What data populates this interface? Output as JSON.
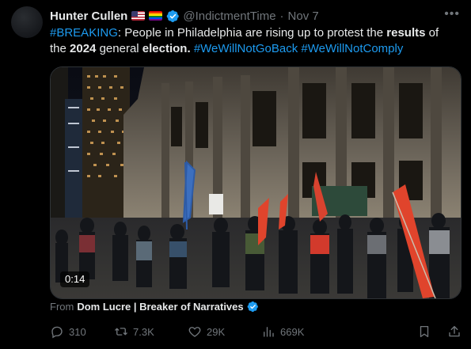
{
  "author": {
    "display_name": "Hunter Cullen",
    "handle": "@IndictmentTime",
    "separator": "·",
    "timestamp": "Nov 7",
    "badges": [
      "us-flag-icon",
      "rainbow-flag-icon",
      "verified-badge-icon"
    ]
  },
  "tweet": {
    "hashtag_breaking": "#BREAKING",
    "text_1": ": People in Philadelphia are rising up to protest the ",
    "bold_results": "results",
    "text_2": " of the ",
    "bold_year": "2024",
    "text_3": " general ",
    "bold_election": "election.",
    "text_4": " ",
    "hashtag_1": "#WeWillNotGoBack",
    "text_5": " ",
    "hashtag_2": "#WeWillNotComply"
  },
  "media": {
    "type": "video",
    "duration": "0:14"
  },
  "source": {
    "prefix": "From",
    "name": "Dom Lucre | Breaker of Narratives"
  },
  "actions": {
    "replies": "310",
    "reposts": "7.3K",
    "likes": "29K",
    "views": "669K"
  },
  "colors": {
    "background": "#000000",
    "text": "#e7e9ea",
    "muted": "#71767b",
    "link": "#1d9bf0",
    "verified": "#1d9bf0",
    "flag_red": "#e0442c"
  }
}
